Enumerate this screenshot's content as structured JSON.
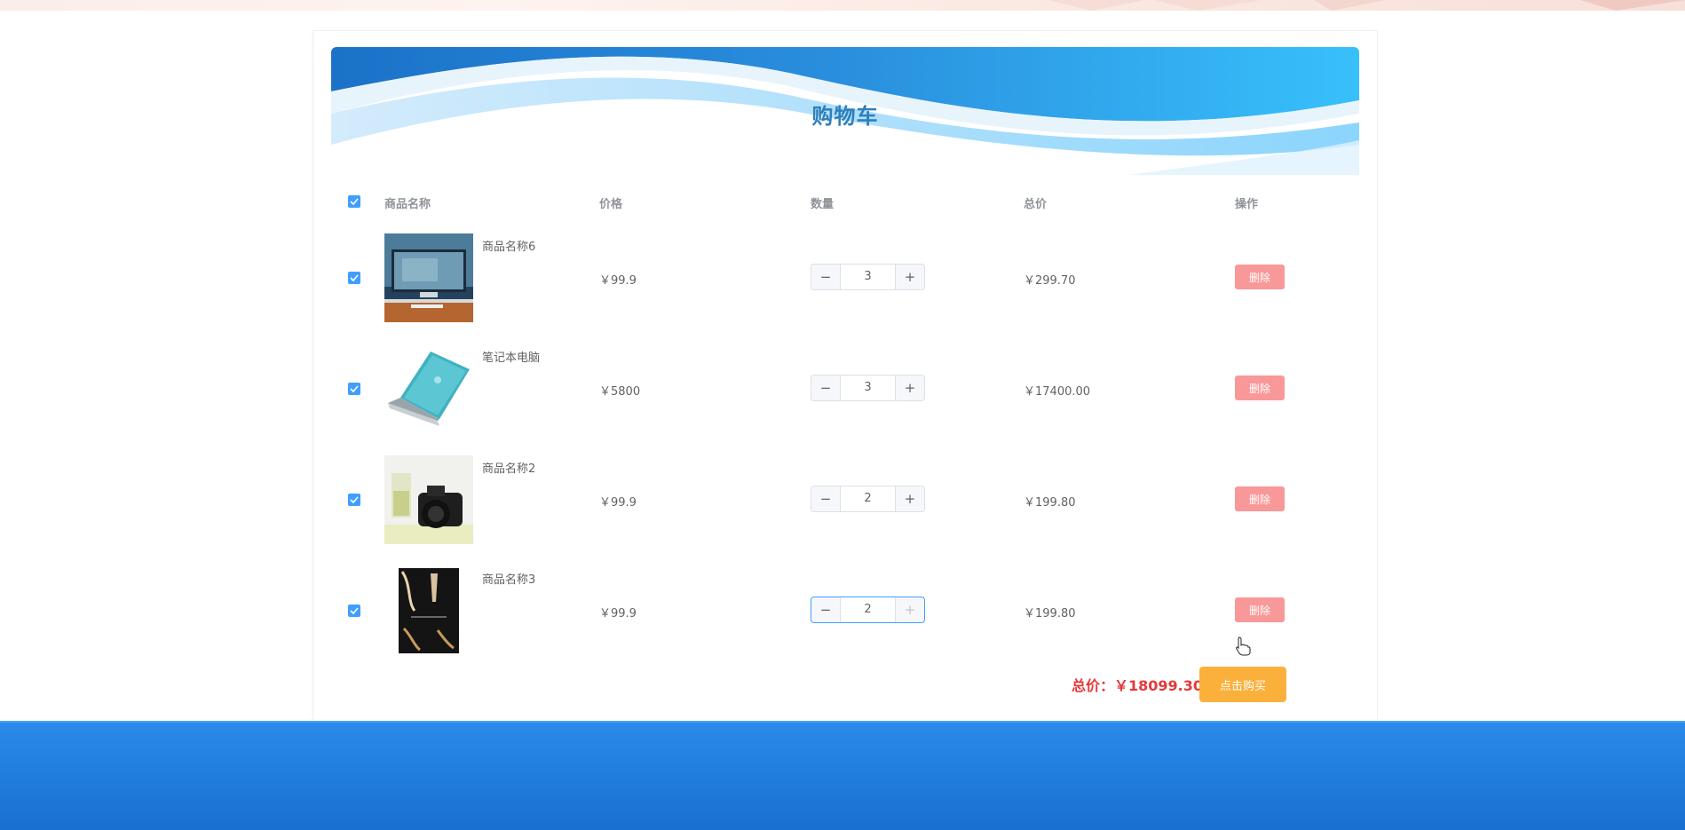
{
  "page": {
    "title": "购物车"
  },
  "table": {
    "headers": {
      "name": "商品名称",
      "price": "价格",
      "quantity": "数量",
      "total": "总价",
      "action": "操作"
    },
    "rows": [
      {
        "name": "商品名称6",
        "price": "￥99.9",
        "quantity": "3",
        "total": "￥299.70",
        "delete": "删除"
      },
      {
        "name": "笔记本电脑",
        "price": "￥5800",
        "quantity": "3",
        "total": "￥17400.00",
        "delete": "删除"
      },
      {
        "name": "商品名称2",
        "price": "￥99.9",
        "quantity": "2",
        "total": "￥199.80",
        "delete": "删除"
      },
      {
        "name": "商品名称3",
        "price": "￥99.9",
        "quantity": "2",
        "total": "￥199.80",
        "delete": "删除"
      }
    ]
  },
  "summary": {
    "label": "总价：￥18099.30",
    "buy_label": "点击购买"
  },
  "colors": {
    "primary": "#409eff",
    "delete": "#f89898",
    "buy": "#fbb03b",
    "total_red": "#e4393c",
    "footer": "#2280e0",
    "title": "#2e7fbd"
  }
}
